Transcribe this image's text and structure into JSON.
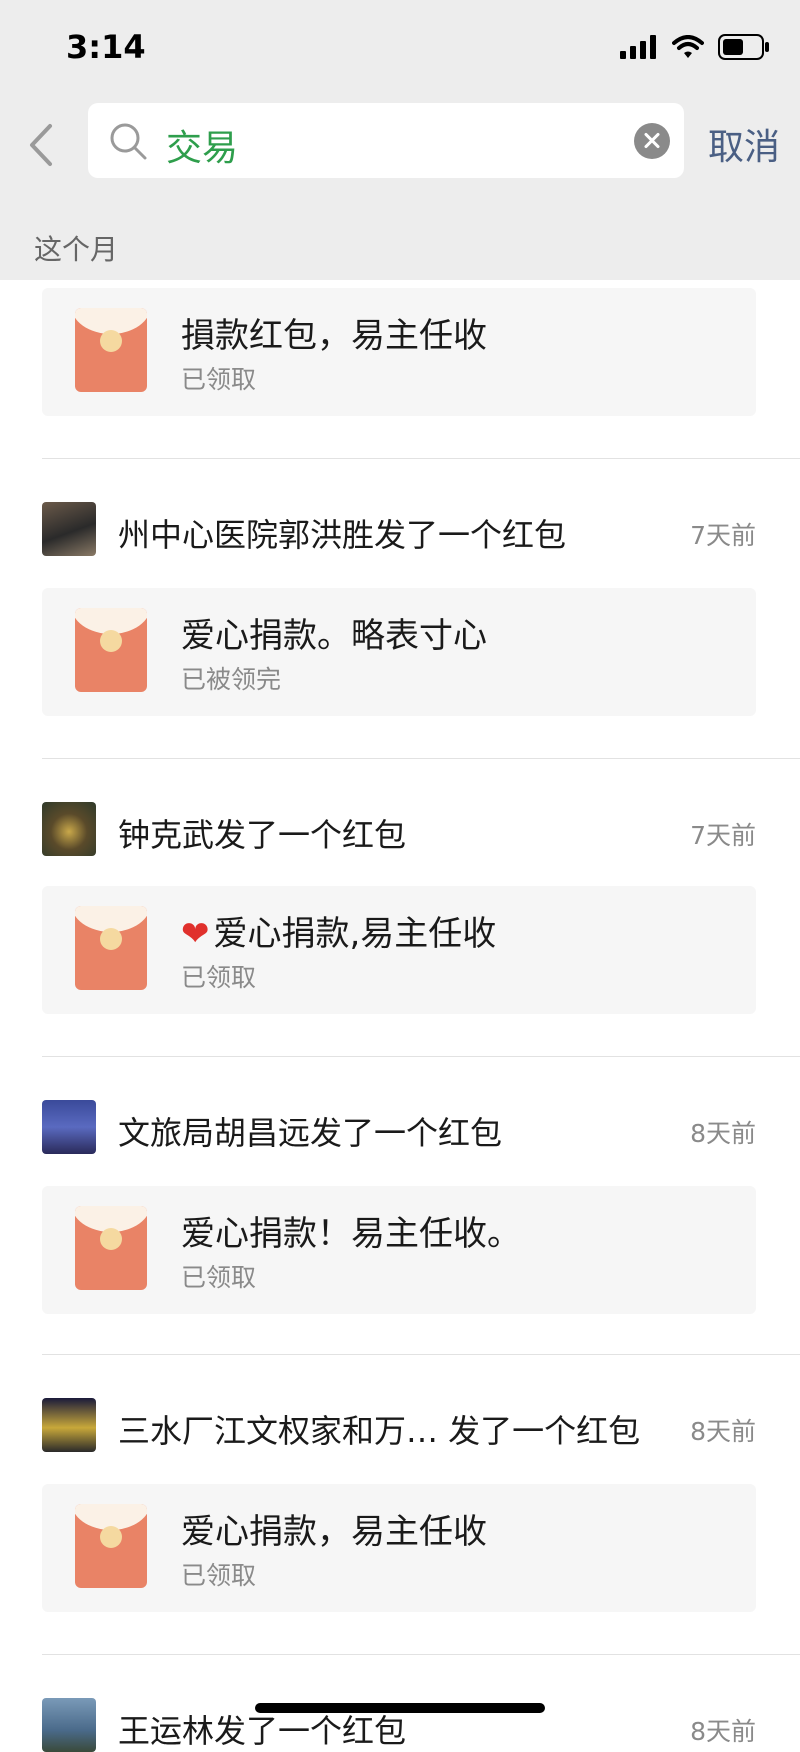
{
  "status_bar": {
    "time": "3:14"
  },
  "search": {
    "query": "交易",
    "cancel_label": "取消"
  },
  "section": {
    "label": "这个月"
  },
  "items": [
    {
      "sender": "",
      "time": "",
      "title": "損款红包，易主任收",
      "status": "已领取",
      "heart": ""
    },
    {
      "sender": "州中心医院郭洪胜发了一个红包",
      "time": "7天前",
      "title": "爱心捐款。略表寸心",
      "status": "已被领完",
      "heart": ""
    },
    {
      "sender": "钟克武发了一个红包",
      "time": "7天前",
      "title": "爱心捐款,易主任收",
      "status": "已领取",
      "heart": "❤"
    },
    {
      "sender": "文旅局胡昌远发了一个红包",
      "time": "8天前",
      "title": "爱心捐款！易主任收。",
      "status": "已领取",
      "heart": ""
    },
    {
      "sender": "三水厂江文权家和万…  发了一个红包",
      "time": "8天前",
      "title": "爱心捐款，易主任收",
      "status": "已领取",
      "heart": ""
    },
    {
      "sender": "王运林发了一个红包",
      "time": "8天前",
      "title": "",
      "status": "",
      "heart": ""
    }
  ],
  "colors": {
    "accent_green": "#2e9e4c",
    "link_blue": "#4a5f84",
    "envelope": "#e98366"
  }
}
